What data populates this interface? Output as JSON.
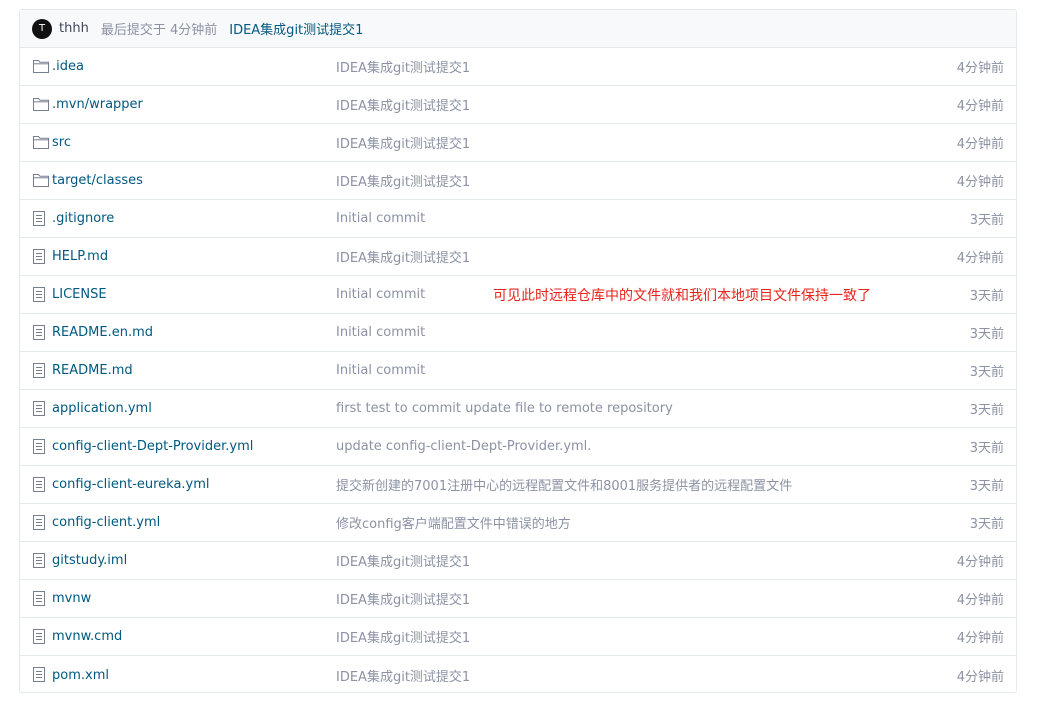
{
  "header": {
    "avatar_letter": "T",
    "author": "thhh",
    "last_commit_text": "最后提交于 4分钟前",
    "commit_message": "IDEA集成git测试提交1"
  },
  "annotation": {
    "text": "可见此时远程仓库中的文件就和我们本地项目文件保持一致了",
    "color": "#e8231b"
  },
  "files": [
    {
      "name": ".idea",
      "type": "folder",
      "commit": "IDEA集成git测试提交1",
      "time": "4分钟前"
    },
    {
      "name": ".mvn/wrapper",
      "type": "folder",
      "commit": "IDEA集成git测试提交1",
      "time": "4分钟前"
    },
    {
      "name": "src",
      "type": "folder",
      "commit": "IDEA集成git测试提交1",
      "time": "4分钟前"
    },
    {
      "name": "target/classes",
      "type": "folder",
      "commit": "IDEA集成git测试提交1",
      "time": "4分钟前"
    },
    {
      "name": ".gitignore",
      "type": "file",
      "commit": "Initial commit",
      "time": "3天前"
    },
    {
      "name": "HELP.md",
      "type": "file",
      "commit": "IDEA集成git测试提交1",
      "time": "4分钟前"
    },
    {
      "name": "LICENSE",
      "type": "file",
      "commit": "Initial commit",
      "time": "3天前"
    },
    {
      "name": "README.en.md",
      "type": "file",
      "commit": "Initial commit",
      "time": "3天前"
    },
    {
      "name": "README.md",
      "type": "file",
      "commit": "Initial commit",
      "time": "3天前"
    },
    {
      "name": "application.yml",
      "type": "file",
      "commit": "first test to commit update file to remote repository",
      "time": "3天前"
    },
    {
      "name": "config-client-Dept-Provider.yml",
      "type": "file",
      "commit": "update config-client-Dept-Provider.yml.",
      "time": "3天前"
    },
    {
      "name": "config-client-eureka.yml",
      "type": "file",
      "commit": "提交新创建的7001注册中心的远程配置文件和8001服务提供者的远程配置文件",
      "time": "3天前"
    },
    {
      "name": "config-client.yml",
      "type": "file",
      "commit": "修改config客户端配置文件中错误的地方",
      "time": "3天前"
    },
    {
      "name": "gitstudy.iml",
      "type": "file",
      "commit": "IDEA集成git测试提交1",
      "time": "4分钟前"
    },
    {
      "name": "mvnw",
      "type": "file",
      "commit": "IDEA集成git测试提交1",
      "time": "4分钟前"
    },
    {
      "name": "mvnw.cmd",
      "type": "file",
      "commit": "IDEA集成git测试提交1",
      "time": "4分钟前"
    },
    {
      "name": "pom.xml",
      "type": "file",
      "commit": "IDEA集成git测试提交1",
      "time": "4分钟前"
    }
  ]
}
